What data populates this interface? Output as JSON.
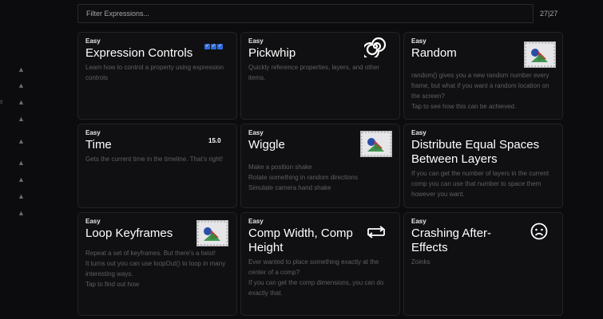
{
  "filter": {
    "placeholder": "Filter Expressions...",
    "count": "27|27"
  },
  "sidebar": {
    "edge_mark": "s"
  },
  "icons": {
    "sidebar_arrow": "cursor-arrow-icon",
    "card_image": "image-placeholder-icon",
    "pickwhip": "spiral-icon",
    "loop": "loop-arrows-icon",
    "crash": "frowning-face-icon",
    "checkbox": "checkbox-checked-icon"
  },
  "cards": [
    {
      "badge": "Easy",
      "title": "Expression Controls",
      "desc": [
        "Learn how to control a property using expression controls"
      ]
    },
    {
      "badge": "Easy",
      "title": "Pickwhip",
      "desc": [
        "Quickly reference properties, layers, and other items."
      ]
    },
    {
      "badge": "Easy",
      "title": "Random",
      "desc": [
        "random() gives you a new random number every frame, but what if you want a random location on the screen?",
        "Tap to see how this can be achieved."
      ]
    },
    {
      "badge": "Easy",
      "title": "Time",
      "time_value": "15.0",
      "desc": [
        "Gets the current time in the timeline. That's right!"
      ]
    },
    {
      "badge": "Easy",
      "title": "Wiggle",
      "desc": [
        "Make a position shake",
        "Rotate something in random directions",
        "Simulate camera hand shake"
      ]
    },
    {
      "badge": "Easy",
      "title": "Distribute Equal Spaces Between Layers",
      "desc": [
        "If you can get the number of layers in the current comp you can use that number to space them however you want."
      ]
    },
    {
      "badge": "Easy",
      "title": "Loop Keyframes",
      "desc": [
        "Repeat a set of keyframes. But there's a twist!",
        "It turns out you can use loopOut() to loop in many interesting ways.",
        "Tap to find out how"
      ]
    },
    {
      "badge": "Easy",
      "title": "Comp Width, Comp Height",
      "desc": [
        "Ever wanted to place something exactly at the center of a comp?",
        "If you can get the comp dimensions, you can do exactly that."
      ]
    },
    {
      "badge": "Easy",
      "title": "Crashing After-Effects",
      "desc": [
        "Zoinks"
      ]
    }
  ],
  "colors": {
    "background": "#0c0c0e",
    "card": "#101012",
    "checkbox": "#2e6bd9",
    "image_red": "#d03a2f",
    "image_green": "#2f8c3e",
    "image_blue": "#2a4ea8"
  }
}
